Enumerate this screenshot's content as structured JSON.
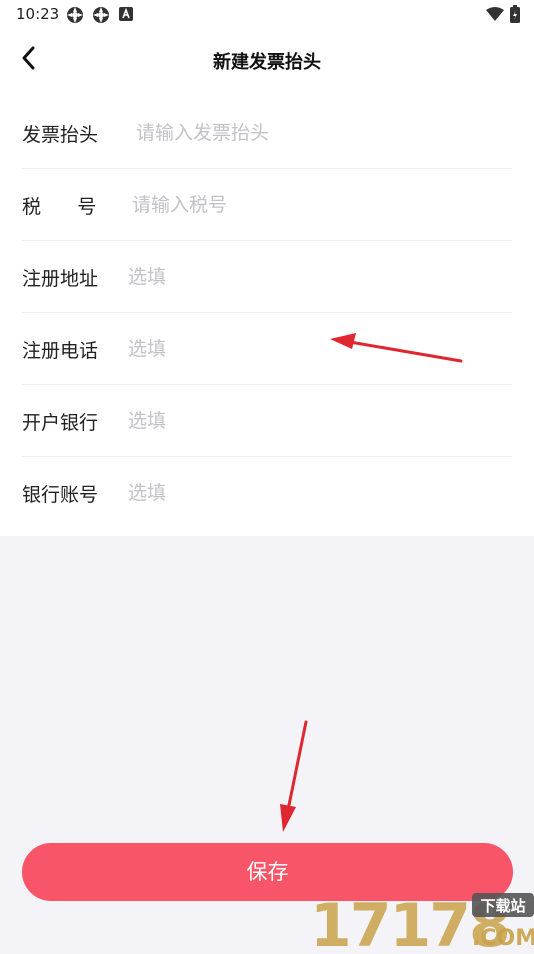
{
  "status_bar": {
    "time": "10:23"
  },
  "header": {
    "title": "新建发票抬头"
  },
  "form": {
    "rows": [
      {
        "label": "发票抬头",
        "placeholder": "请输入发票抬头",
        "value": ""
      },
      {
        "label": "税      号",
        "placeholder": "请输入税号",
        "value": ""
      },
      {
        "label": "注册地址",
        "placeholder": "选填",
        "value": ""
      },
      {
        "label": "注册电话",
        "placeholder": "选填",
        "value": ""
      },
      {
        "label": "开户银行",
        "placeholder": "选填",
        "value": ""
      },
      {
        "label": "银行账号",
        "placeholder": "选填",
        "value": ""
      }
    ]
  },
  "actions": {
    "save_label": "保存"
  },
  "watermark": {
    "number": "17178",
    "tag": "下载站",
    "domain": ".COM"
  },
  "colors": {
    "accent": "#f85568",
    "annotation_arrow": "#e0262e",
    "watermark_gold": "#c9a24a"
  }
}
